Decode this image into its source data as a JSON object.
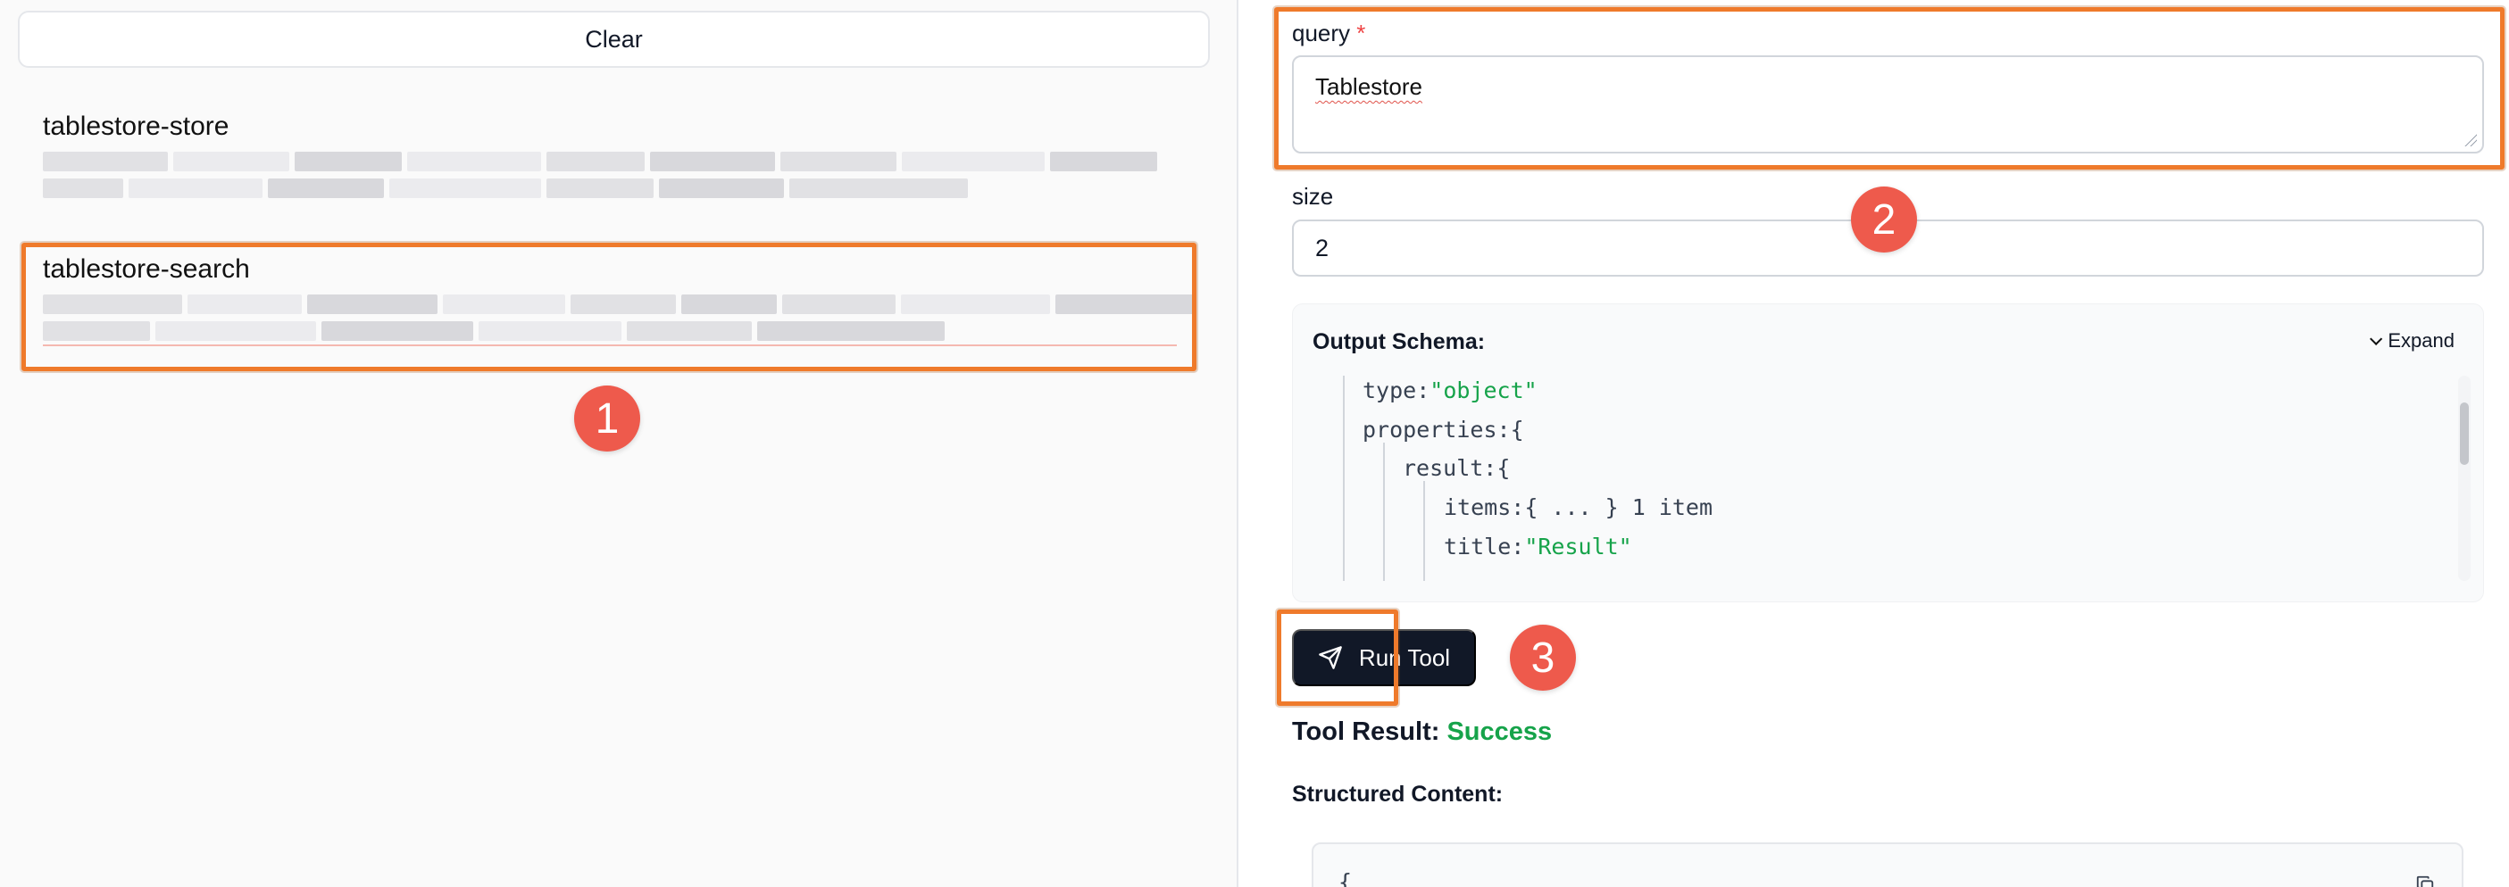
{
  "left": {
    "clear_label": "Clear",
    "tools": [
      {
        "name": "tablestore-store"
      },
      {
        "name": "tablestore-search"
      }
    ]
  },
  "annotations": {
    "badge1": "1",
    "badge2": "2",
    "badge3": "3",
    "highlight_color": "#ef7a2b",
    "badge_color": "#ee5a4c"
  },
  "form": {
    "query_label": "query",
    "required_mark": "*",
    "query_value": "Tablestore",
    "size_label": "size",
    "size_value": "2"
  },
  "schema": {
    "title": "Output Schema:",
    "expand_label": "Expand",
    "lines": [
      {
        "key": "type:",
        "value": "\"object\""
      },
      {
        "key": "properties:",
        "value": "{"
      },
      {
        "key": "result:",
        "value": "{"
      },
      {
        "key": "items:",
        "value": "{ ... } 1 item"
      },
      {
        "key": "title:",
        "value": "\"Result\""
      }
    ]
  },
  "run_button": {
    "label": "Run Tool",
    "icon": "send-icon"
  },
  "result": {
    "label": "Tool Result:",
    "status": "Success",
    "status_color": "#16a34a",
    "structured_label": "Structured Content:",
    "structured_open": "{"
  }
}
